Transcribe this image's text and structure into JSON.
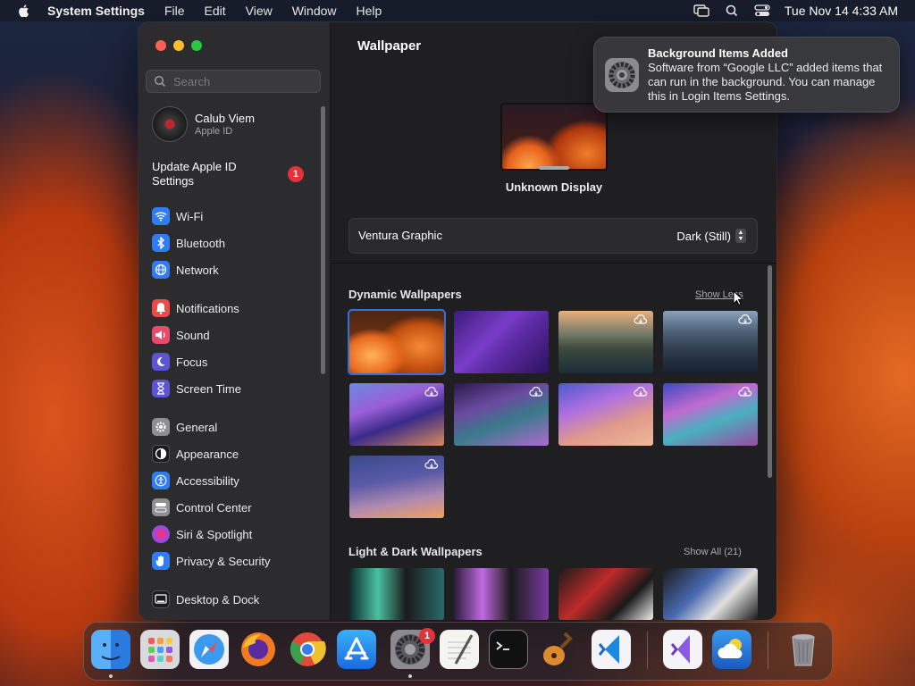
{
  "menubar": {
    "app_name": "System Settings",
    "menus": [
      "File",
      "Edit",
      "View",
      "Window",
      "Help"
    ],
    "clock": "Tue Nov 14  4:33 AM",
    "status_icons": [
      "screen-mirroring-icon",
      "spotlight-search-icon",
      "control-center-icon"
    ]
  },
  "sidebar": {
    "search_placeholder": "Search",
    "account": {
      "name": "Calub Viem",
      "subtitle": "Apple ID"
    },
    "update": {
      "label": "Update Apple ID Settings",
      "badge": "1"
    },
    "items": [
      {
        "label": "Wi-Fi",
        "icon": "wifi-icon",
        "color": "#2f7cf6"
      },
      {
        "label": "Bluetooth",
        "icon": "bluetooth-icon",
        "color": "#2f7cf6"
      },
      {
        "label": "Network",
        "icon": "globe-icon",
        "color": "#2f7cf6"
      },
      {
        "label": "Notifications",
        "icon": "bell-icon",
        "color": "#ea4a4a"
      },
      {
        "label": "Sound",
        "icon": "speaker-icon",
        "color": "#ea4a6a"
      },
      {
        "label": "Focus",
        "icon": "moon-icon",
        "color": "#5b55d6"
      },
      {
        "label": "Screen Time",
        "icon": "hourglass-icon",
        "color": "#5b55d6"
      },
      {
        "label": "General",
        "icon": "gear-icon",
        "color": "#8e8e93"
      },
      {
        "label": "Appearance",
        "icon": "appearance-icon",
        "color": "#1c1c1e"
      },
      {
        "label": "Accessibility",
        "icon": "accessibility-icon",
        "color": "#2f7cf6"
      },
      {
        "label": "Control Center",
        "icon": "control-center-icon",
        "color": "#8e8e93"
      },
      {
        "label": "Siri & Spotlight",
        "icon": "siri-icon",
        "color": "#b43fd6"
      },
      {
        "label": "Privacy & Security",
        "icon": "hand-icon",
        "color": "#2f7cf6"
      },
      {
        "label": "Desktop & Dock",
        "icon": "desktop-icon",
        "color": "#1c1c1e"
      }
    ]
  },
  "content": {
    "title": "Wallpaper",
    "display_name": "Unknown Display",
    "wallpaper_name": "Ventura Graphic",
    "appearance_value": "Dark (Still)",
    "dynamic_section": {
      "title": "Dynamic Wallpapers",
      "link": "Show Less"
    },
    "light_dark_section": {
      "title": "Light & Dark Wallpapers",
      "link": "Show All (21)"
    }
  },
  "notification": {
    "title": "Background Items Added",
    "body": "Software from “Google LLC” added items that can run in the background. You can manage this in Login Items Settings.",
    "icon": "system-settings-gear-icon"
  },
  "dock": {
    "apps": [
      "Finder",
      "Launchpad",
      "Safari",
      "Firefox",
      "Google Chrome",
      "App Store",
      "System Settings",
      "TextEdit",
      "Terminal",
      "GarageBand",
      "Visual Studio Code",
      "Visual Studio",
      "Weather",
      "Trash"
    ],
    "settings_badge": "1"
  }
}
